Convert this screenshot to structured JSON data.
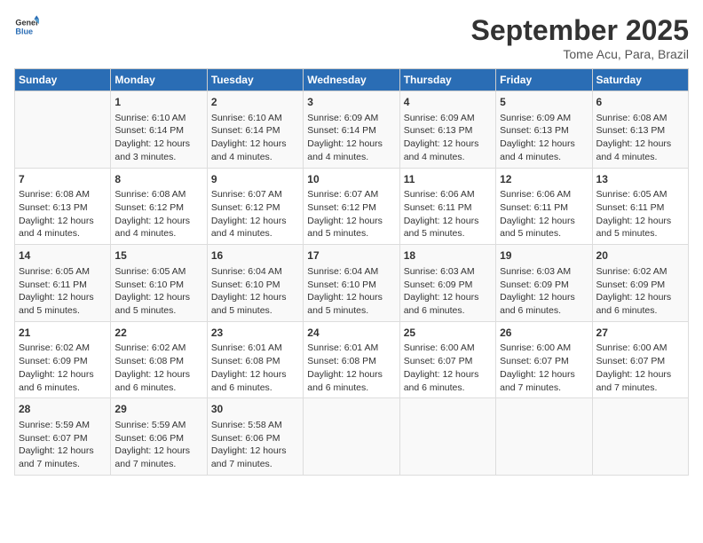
{
  "header": {
    "logo_general": "General",
    "logo_blue": "Blue",
    "month": "September 2025",
    "location": "Tome Acu, Para, Brazil"
  },
  "days_of_week": [
    "Sunday",
    "Monday",
    "Tuesday",
    "Wednesday",
    "Thursday",
    "Friday",
    "Saturday"
  ],
  "weeks": [
    [
      {
        "day": "",
        "info": ""
      },
      {
        "day": "1",
        "info": "Sunrise: 6:10 AM\nSunset: 6:14 PM\nDaylight: 12 hours\nand 3 minutes."
      },
      {
        "day": "2",
        "info": "Sunrise: 6:10 AM\nSunset: 6:14 PM\nDaylight: 12 hours\nand 4 minutes."
      },
      {
        "day": "3",
        "info": "Sunrise: 6:09 AM\nSunset: 6:14 PM\nDaylight: 12 hours\nand 4 minutes."
      },
      {
        "day": "4",
        "info": "Sunrise: 6:09 AM\nSunset: 6:13 PM\nDaylight: 12 hours\nand 4 minutes."
      },
      {
        "day": "5",
        "info": "Sunrise: 6:09 AM\nSunset: 6:13 PM\nDaylight: 12 hours\nand 4 minutes."
      },
      {
        "day": "6",
        "info": "Sunrise: 6:08 AM\nSunset: 6:13 PM\nDaylight: 12 hours\nand 4 minutes."
      }
    ],
    [
      {
        "day": "7",
        "info": "Sunrise: 6:08 AM\nSunset: 6:13 PM\nDaylight: 12 hours\nand 4 minutes."
      },
      {
        "day": "8",
        "info": "Sunrise: 6:08 AM\nSunset: 6:12 PM\nDaylight: 12 hours\nand 4 minutes."
      },
      {
        "day": "9",
        "info": "Sunrise: 6:07 AM\nSunset: 6:12 PM\nDaylight: 12 hours\nand 4 minutes."
      },
      {
        "day": "10",
        "info": "Sunrise: 6:07 AM\nSunset: 6:12 PM\nDaylight: 12 hours\nand 5 minutes."
      },
      {
        "day": "11",
        "info": "Sunrise: 6:06 AM\nSunset: 6:11 PM\nDaylight: 12 hours\nand 5 minutes."
      },
      {
        "day": "12",
        "info": "Sunrise: 6:06 AM\nSunset: 6:11 PM\nDaylight: 12 hours\nand 5 minutes."
      },
      {
        "day": "13",
        "info": "Sunrise: 6:05 AM\nSunset: 6:11 PM\nDaylight: 12 hours\nand 5 minutes."
      }
    ],
    [
      {
        "day": "14",
        "info": "Sunrise: 6:05 AM\nSunset: 6:11 PM\nDaylight: 12 hours\nand 5 minutes."
      },
      {
        "day": "15",
        "info": "Sunrise: 6:05 AM\nSunset: 6:10 PM\nDaylight: 12 hours\nand 5 minutes."
      },
      {
        "day": "16",
        "info": "Sunrise: 6:04 AM\nSunset: 6:10 PM\nDaylight: 12 hours\nand 5 minutes."
      },
      {
        "day": "17",
        "info": "Sunrise: 6:04 AM\nSunset: 6:10 PM\nDaylight: 12 hours\nand 5 minutes."
      },
      {
        "day": "18",
        "info": "Sunrise: 6:03 AM\nSunset: 6:09 PM\nDaylight: 12 hours\nand 6 minutes."
      },
      {
        "day": "19",
        "info": "Sunrise: 6:03 AM\nSunset: 6:09 PM\nDaylight: 12 hours\nand 6 minutes."
      },
      {
        "day": "20",
        "info": "Sunrise: 6:02 AM\nSunset: 6:09 PM\nDaylight: 12 hours\nand 6 minutes."
      }
    ],
    [
      {
        "day": "21",
        "info": "Sunrise: 6:02 AM\nSunset: 6:09 PM\nDaylight: 12 hours\nand 6 minutes."
      },
      {
        "day": "22",
        "info": "Sunrise: 6:02 AM\nSunset: 6:08 PM\nDaylight: 12 hours\nand 6 minutes."
      },
      {
        "day": "23",
        "info": "Sunrise: 6:01 AM\nSunset: 6:08 PM\nDaylight: 12 hours\nand 6 minutes."
      },
      {
        "day": "24",
        "info": "Sunrise: 6:01 AM\nSunset: 6:08 PM\nDaylight: 12 hours\nand 6 minutes."
      },
      {
        "day": "25",
        "info": "Sunrise: 6:00 AM\nSunset: 6:07 PM\nDaylight: 12 hours\nand 6 minutes."
      },
      {
        "day": "26",
        "info": "Sunrise: 6:00 AM\nSunset: 6:07 PM\nDaylight: 12 hours\nand 7 minutes."
      },
      {
        "day": "27",
        "info": "Sunrise: 6:00 AM\nSunset: 6:07 PM\nDaylight: 12 hours\nand 7 minutes."
      }
    ],
    [
      {
        "day": "28",
        "info": "Sunrise: 5:59 AM\nSunset: 6:07 PM\nDaylight: 12 hours\nand 7 minutes."
      },
      {
        "day": "29",
        "info": "Sunrise: 5:59 AM\nSunset: 6:06 PM\nDaylight: 12 hours\nand 7 minutes."
      },
      {
        "day": "30",
        "info": "Sunrise: 5:58 AM\nSunset: 6:06 PM\nDaylight: 12 hours\nand 7 minutes."
      },
      {
        "day": "",
        "info": ""
      },
      {
        "day": "",
        "info": ""
      },
      {
        "day": "",
        "info": ""
      },
      {
        "day": "",
        "info": ""
      }
    ]
  ]
}
